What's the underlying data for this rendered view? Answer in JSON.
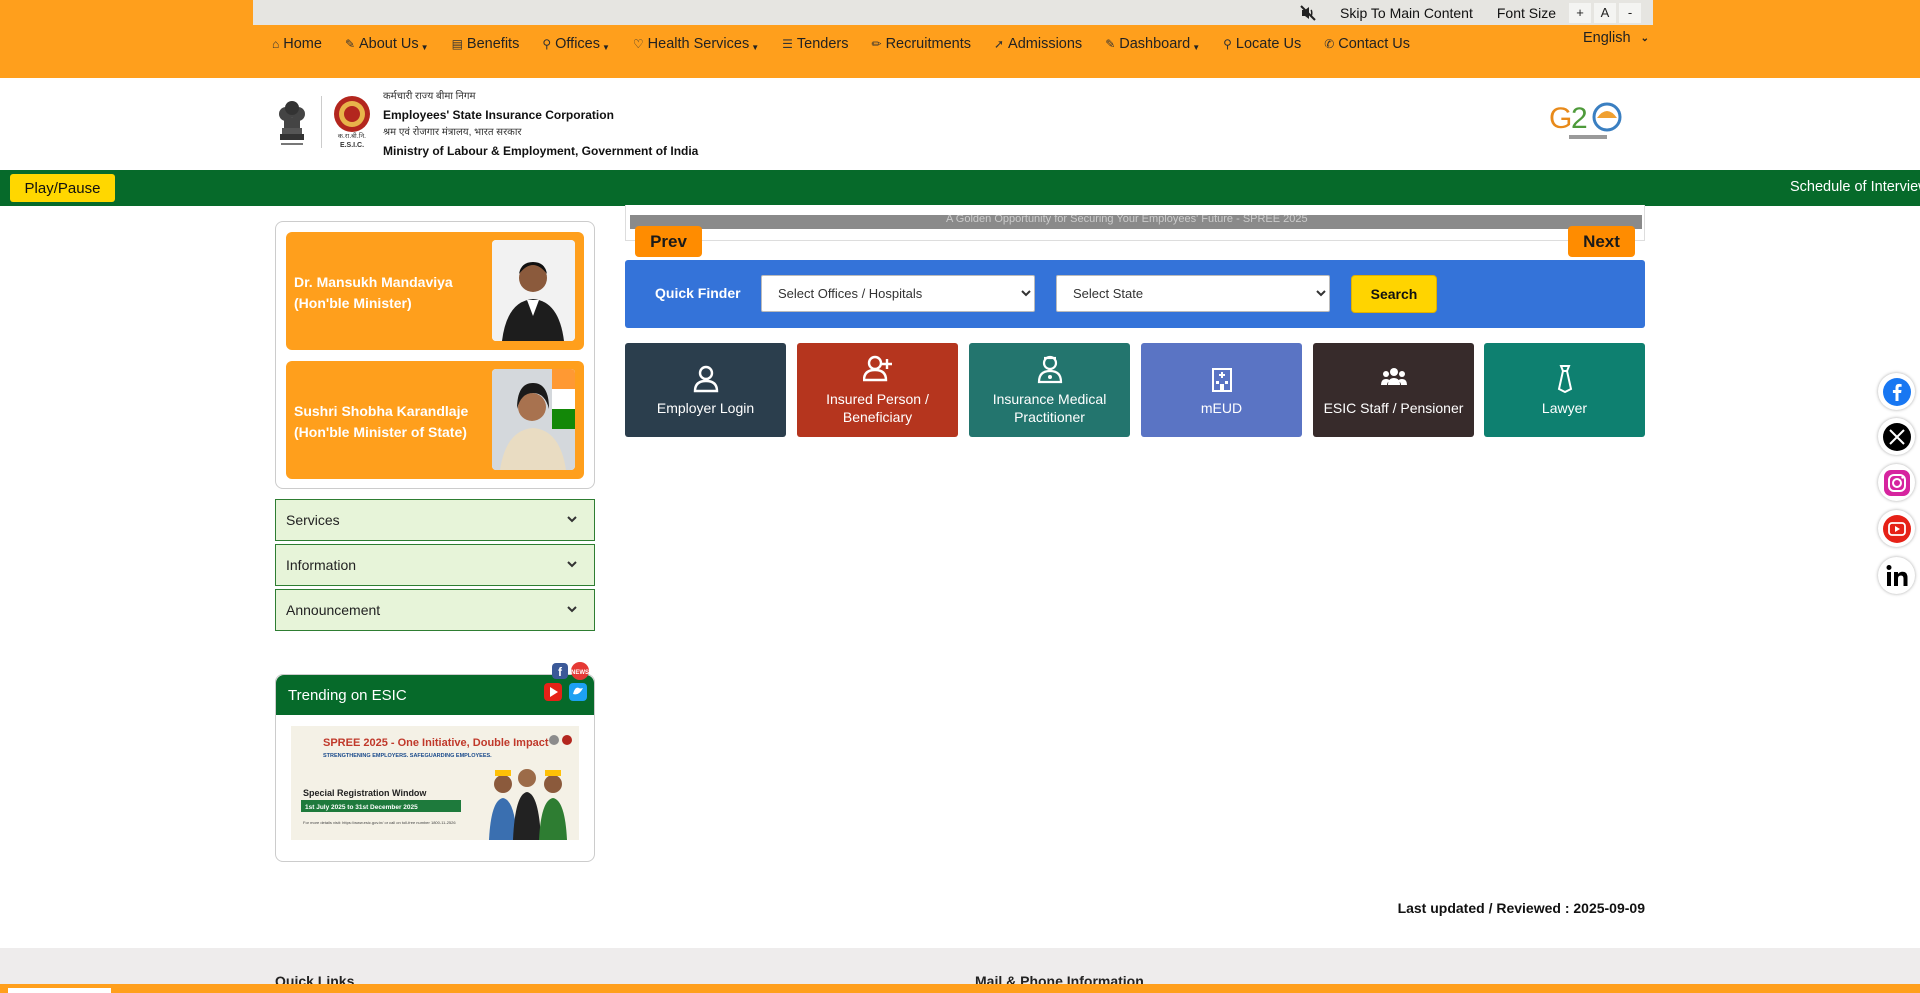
{
  "utility_bar": {
    "skip_link": "Skip To Main Content",
    "font_size_label": "Font Size",
    "font_increase": "+",
    "font_normal": "A",
    "font_decrease": "-"
  },
  "nav": {
    "items": [
      {
        "label": "Home",
        "icon": "home-icon",
        "glyph": "⌂",
        "dropdown": false
      },
      {
        "label": "About Us",
        "icon": "edit-icon",
        "glyph": "✎",
        "dropdown": true
      },
      {
        "label": "Benefits",
        "icon": "money-icon",
        "glyph": "▤",
        "dropdown": false
      },
      {
        "label": "Offices",
        "icon": "location-pin-icon",
        "glyph": "⚲",
        "dropdown": true
      },
      {
        "label": "Health Services",
        "icon": "heart-pulse-icon",
        "glyph": "♡",
        "dropdown": true
      },
      {
        "label": "Tenders",
        "icon": "list-icon",
        "glyph": "☰",
        "dropdown": false
      },
      {
        "label": "Recruitments",
        "icon": "pencil-icon",
        "glyph": "✏",
        "dropdown": false
      },
      {
        "label": "Admissions",
        "icon": "rocket-icon",
        "glyph": "➚",
        "dropdown": false
      },
      {
        "label": "Dashboard",
        "icon": "edit-icon",
        "glyph": "✎",
        "dropdown": true
      },
      {
        "label": "Locate Us",
        "icon": "location-pin-icon",
        "glyph": "⚲",
        "dropdown": false
      },
      {
        "label": "Contact Us",
        "icon": "phone-icon",
        "glyph": "✆",
        "dropdown": false
      }
    ],
    "language": "English"
  },
  "header": {
    "org_hindi": "कर्मचारी राज्य बीमा निगम",
    "org_english": "Employees' State Insurance Corporation",
    "ministry_hindi": "श्रम एवं रोजगार मंत्रालय, भारत सरकार",
    "ministry_english": "Ministry of Labour & Employment, Government of India",
    "esic_logo_text": "E.S.I.C.",
    "esic_logo_hindi": "क.रा.बी.नि."
  },
  "ticker": {
    "play_pause_label": "Play/Pause",
    "text": "Schedule of Interview"
  },
  "ministers": [
    {
      "name": "Dr. Mansukh Mandaviya (Hon'ble Minister)"
    },
    {
      "name": "Sushri Shobha Karandlaje (Hon'ble Minister of State)"
    }
  ],
  "accordions": [
    {
      "label": "Services"
    },
    {
      "label": "Information"
    },
    {
      "label": "Announcement"
    }
  ],
  "trending": {
    "title": "Trending on ESIC",
    "banner_title": "SPREE 2025 - One Initiative, Double Impact",
    "banner_sub": "STRENGTHENING EMPLOYERS. SAFEGUARDING EMPLOYEES.",
    "banner_window": "Special Registration Window",
    "banner_dates": "1st July 2025 to 31st December 2025",
    "banner_more": "For more details visit: https://www.esic.gov.in/ or call on toll-free number 1800-11-2526"
  },
  "carousel": {
    "caption": "A Golden Opportunity for Securing Your Employees' Future - SPREE 2025",
    "prev_label": "Prev",
    "next_label": "Next"
  },
  "quick_finder": {
    "label": "Quick Finder",
    "office_select": "Select Offices / Hospitals",
    "state_select": "Select State",
    "search_label": "Search"
  },
  "tiles": [
    {
      "label": "Employer Login",
      "icon": "user-icon",
      "color": "#2b3e4d"
    },
    {
      "label": "Insured Person / Beneficiary",
      "icon": "user-plus-icon",
      "color": "#b5351e"
    },
    {
      "label": "Insurance Medical Practitioner",
      "icon": "doctor-icon",
      "color": "#23756e"
    },
    {
      "label": "mEUD",
      "icon": "hospital-icon",
      "color": "#5a74c4"
    },
    {
      "label": "ESIC Staff / Pensioner",
      "icon": "group-icon",
      "color": "#372b2b"
    },
    {
      "label": "Lawyer",
      "icon": "tie-icon",
      "color": "#0e8070"
    }
  ],
  "last_updated": "Last updated / Reviewed : 2025-09-09",
  "footer": {
    "quick_links": "Quick Links",
    "mail_phone": "Mail & Phone Information"
  },
  "colors": {
    "orange": "#ff9f1c",
    "green": "#066a2a",
    "blue": "#3473d9",
    "yellow": "#ffd400"
  }
}
